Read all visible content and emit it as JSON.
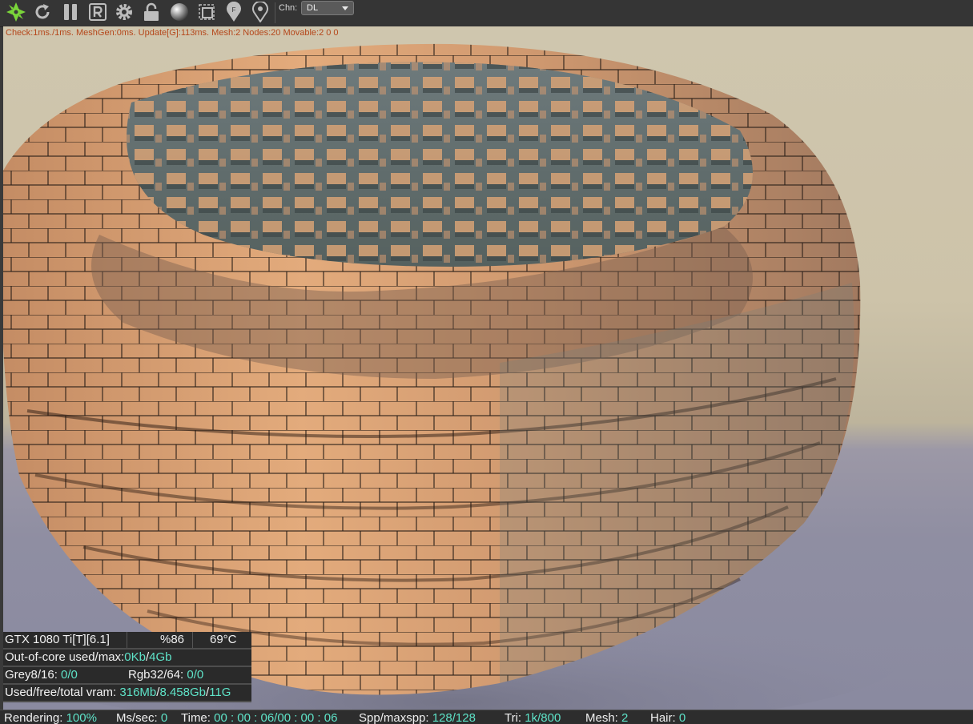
{
  "toolbar": {
    "icons": [
      "octane-logo-icon",
      "refresh-icon",
      "pause-icon",
      "r-icon",
      "gear-icon",
      "lock-icon",
      "material-ball-icon",
      "region-icon",
      "focus-pin-icon",
      "white-pin-icon"
    ],
    "channel_label": "Chn:",
    "channel_value": "DL"
  },
  "viewport": {
    "stats": "Check:1ms./1ms. MeshGen:0ms. Update[G]:113ms. Mesh:2 Nodes:20 Movable:2  0 0"
  },
  "info": {
    "gpu_name": "GTX 1080 Ti[T][6.1]",
    "gpu_usage": "%86",
    "gpu_temp": "69°C",
    "ooc_label": "Out-of-core used/max:",
    "ooc_used": "0Kb",
    "ooc_sep": "/",
    "ooc_max": "4Gb",
    "grey_label": "Grey8/16:",
    "grey_value": "0/0",
    "rgb_label": "Rgb32/64:",
    "rgb_value": "0/0",
    "vram_label": "Used/free/total vram:",
    "vram_used": "316Mb",
    "vram_sep1": "/",
    "vram_free": "8.458Gb",
    "vram_sep2": "/",
    "vram_total": "11G"
  },
  "status": {
    "rendering_label": "Rendering:",
    "rendering_value": "100%",
    "ms_label": "Ms/sec:",
    "ms_value": "0",
    "time_label": "Time:",
    "time_value": "00 : 00 : 06/00 : 00 : 06",
    "spp_label": "Spp/maxspp:",
    "spp_value": "128/128",
    "tri_label": "Tri:",
    "tri_value": "1k/800",
    "mesh_label": "Mesh:",
    "mesh_value": "2",
    "hair_label": "Hair:",
    "hair_value": "0"
  },
  "colors": {
    "highlight": "#5ee3c8",
    "stats_text": "#b5471b",
    "background_wall": "#cdc3a9",
    "floor": "#8f8ea2",
    "object": "#d9a072"
  }
}
